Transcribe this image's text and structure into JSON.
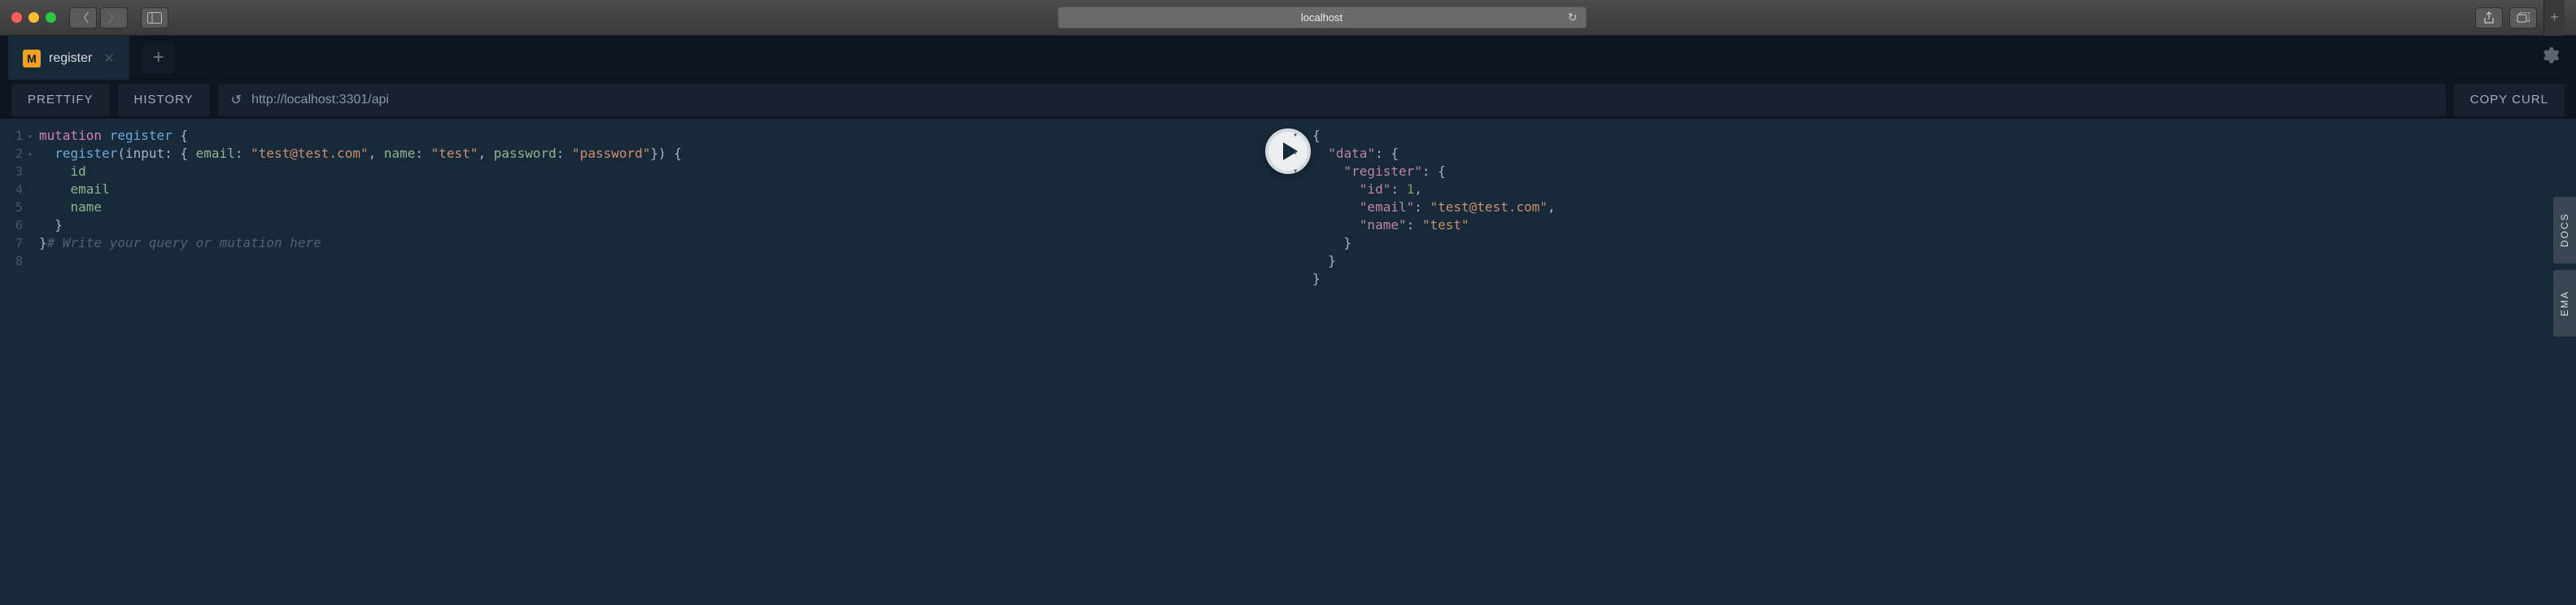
{
  "browser": {
    "address": "localhost"
  },
  "tabs": {
    "active_badge": "M",
    "active_name": "register"
  },
  "toolbar": {
    "prettify": "PRETTIFY",
    "history": "HISTORY",
    "endpoint": "http://localhost:3301/api",
    "copy_curl": "COPY CURL"
  },
  "editor": {
    "gutter": [
      "1",
      "2",
      "3",
      "4",
      "5",
      "6",
      "7",
      "8"
    ],
    "fold": [
      "▾",
      "▾",
      "",
      "",
      "",
      "",
      "",
      ""
    ],
    "lines": [
      [
        [
          "kw",
          "mutation"
        ],
        [
          "punc",
          " "
        ],
        [
          "fn",
          "register"
        ],
        [
          "punc",
          " {"
        ]
      ],
      [
        [
          "punc",
          "  "
        ],
        [
          "fn",
          "register"
        ],
        [
          "punc",
          "(input: { "
        ],
        [
          "attr",
          "email"
        ],
        [
          "punc",
          ": "
        ],
        [
          "str",
          "\"test@test.com\""
        ],
        [
          "punc",
          ", "
        ],
        [
          "attr",
          "name"
        ],
        [
          "punc",
          ": "
        ],
        [
          "str",
          "\"test\""
        ],
        [
          "punc",
          ", "
        ],
        [
          "attr",
          "password"
        ],
        [
          "punc",
          ": "
        ],
        [
          "str",
          "\"password\""
        ],
        [
          "punc",
          "}) {"
        ]
      ],
      [
        [
          "punc",
          "    "
        ],
        [
          "attr",
          "id"
        ]
      ],
      [
        [
          "punc",
          "    "
        ],
        [
          "attr",
          "email"
        ]
      ],
      [
        [
          "punc",
          "    "
        ],
        [
          "attr",
          "name"
        ]
      ],
      [
        [
          "punc",
          "  }"
        ]
      ],
      [
        [
          "punc",
          "}"
        ],
        [
          "cm",
          "# Write your query or mutation here"
        ]
      ],
      [
        [
          "punc",
          ""
        ]
      ]
    ]
  },
  "result": {
    "fold": [
      "▾",
      "▾",
      "▾",
      "",
      "",
      "",
      "",
      "",
      ""
    ],
    "lines": [
      [
        [
          "punc",
          "{"
        ]
      ],
      [
        [
          "punc",
          "  "
        ],
        [
          "jk",
          "\"data\""
        ],
        [
          "punc",
          ": {"
        ]
      ],
      [
        [
          "punc",
          "    "
        ],
        [
          "jk",
          "\"register\""
        ],
        [
          "punc",
          ": {"
        ]
      ],
      [
        [
          "punc",
          "      "
        ],
        [
          "jk",
          "\"id\""
        ],
        [
          "punc",
          ": "
        ],
        [
          "jn",
          "1"
        ],
        [
          "punc",
          ","
        ]
      ],
      [
        [
          "punc",
          "      "
        ],
        [
          "jk",
          "\"email\""
        ],
        [
          "punc",
          ": "
        ],
        [
          "js",
          "\"test@test.com\""
        ],
        [
          "punc",
          ","
        ]
      ],
      [
        [
          "punc",
          "      "
        ],
        [
          "jk",
          "\"name\""
        ],
        [
          "punc",
          ": "
        ],
        [
          "js",
          "\"test\""
        ]
      ],
      [
        [
          "punc",
          "    }"
        ]
      ],
      [
        [
          "punc",
          "  }"
        ]
      ],
      [
        [
          "punc",
          "}"
        ]
      ]
    ]
  },
  "side_tabs": {
    "docs": "DOCS",
    "schema": "EMA"
  }
}
